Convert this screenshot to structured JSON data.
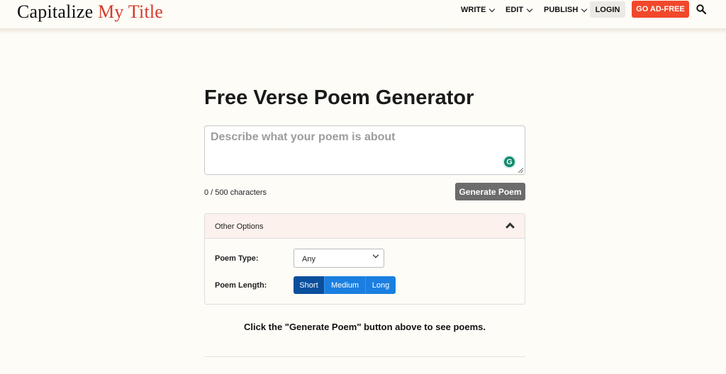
{
  "header": {
    "logo_primary": "Capitalize",
    "logo_accent": "My Title",
    "nav": [
      {
        "label": "WRITE"
      },
      {
        "label": "EDIT"
      },
      {
        "label": "PUBLISH"
      }
    ],
    "login_label": "LOGIN",
    "adfree_label": "GO AD-FREE",
    "search_icon": "search-icon"
  },
  "main": {
    "title": "Free Verse Poem Generator",
    "textarea": {
      "placeholder": "Describe what your poem is about",
      "value": ""
    },
    "grammarly_letter": "G",
    "char_count": "0 / 500 characters",
    "generate_label": "Generate Poem",
    "options": {
      "header_label": "Other Options",
      "poem_type_label": "Poem Type:",
      "poem_type_value": "Any",
      "poem_length_label": "Poem Length:",
      "lengths": [
        {
          "label": "Short",
          "active": true
        },
        {
          "label": "Medium",
          "active": false
        },
        {
          "label": "Long",
          "active": false
        }
      ]
    },
    "hint": "Click the \"Generate Poem\" button above to see poems."
  },
  "colors": {
    "background": "#fdfcf7",
    "brand_accent": "#d23b2a",
    "adfree_button": "#f1482b",
    "segment_blue": "#1a7fe0",
    "segment_active": "#0a4f9c",
    "generate_button": "#6c6c6c"
  }
}
